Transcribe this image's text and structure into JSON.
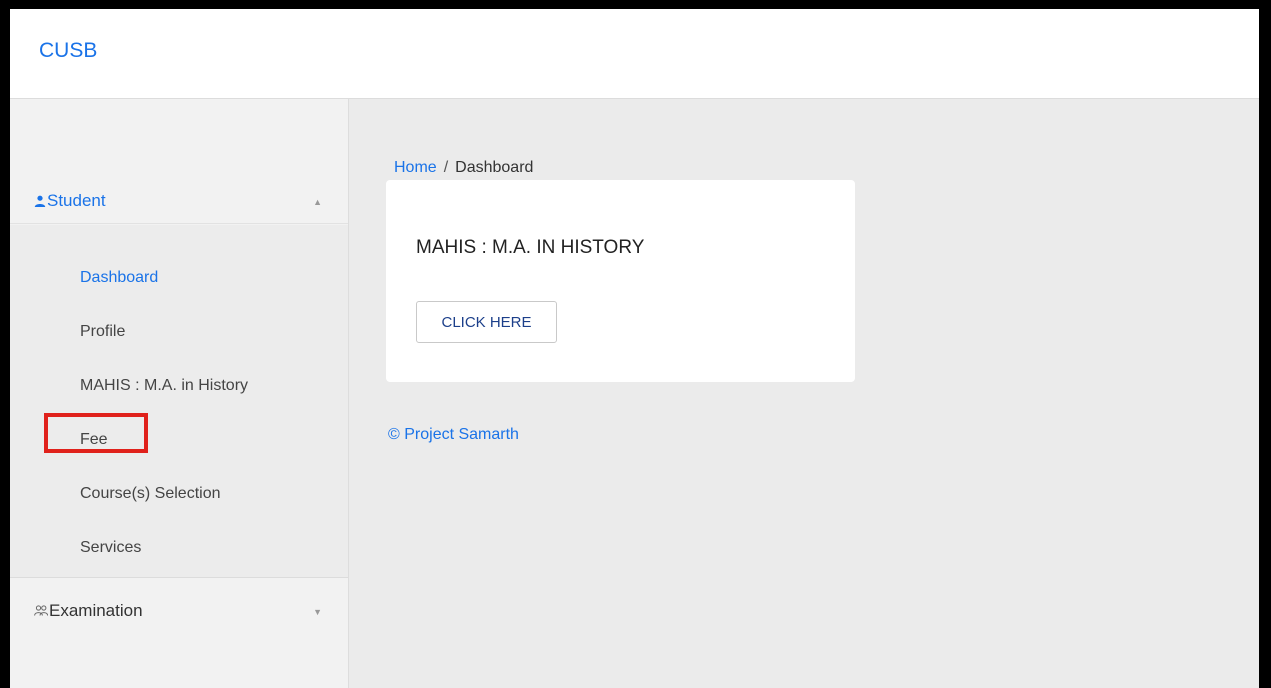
{
  "header": {
    "brand": "CUSB"
  },
  "sidebar": {
    "student": {
      "icon": "person-icon",
      "label": "Student",
      "caret": "▲",
      "items": [
        {
          "label": "Dashboard",
          "active": true
        },
        {
          "label": "Profile"
        },
        {
          "label": "MAHIS : M.A. in History"
        },
        {
          "label": "Fee"
        },
        {
          "label": "Course(s) Selection"
        },
        {
          "label": "Services"
        }
      ]
    },
    "examination": {
      "icon": "group-icon",
      "label": "Examination",
      "caret": "▼"
    }
  },
  "breadcrumb": {
    "home": "Home",
    "separator": "/",
    "current": "Dashboard"
  },
  "card": {
    "title": "MAHIS : M.A. IN HISTORY",
    "button": "CLICK HERE"
  },
  "footer": {
    "text": "© Project Samarth"
  },
  "colors": {
    "accent": "#1a73e8",
    "highlight_box": "#e0211b",
    "button_text": "#1c3f8a"
  }
}
